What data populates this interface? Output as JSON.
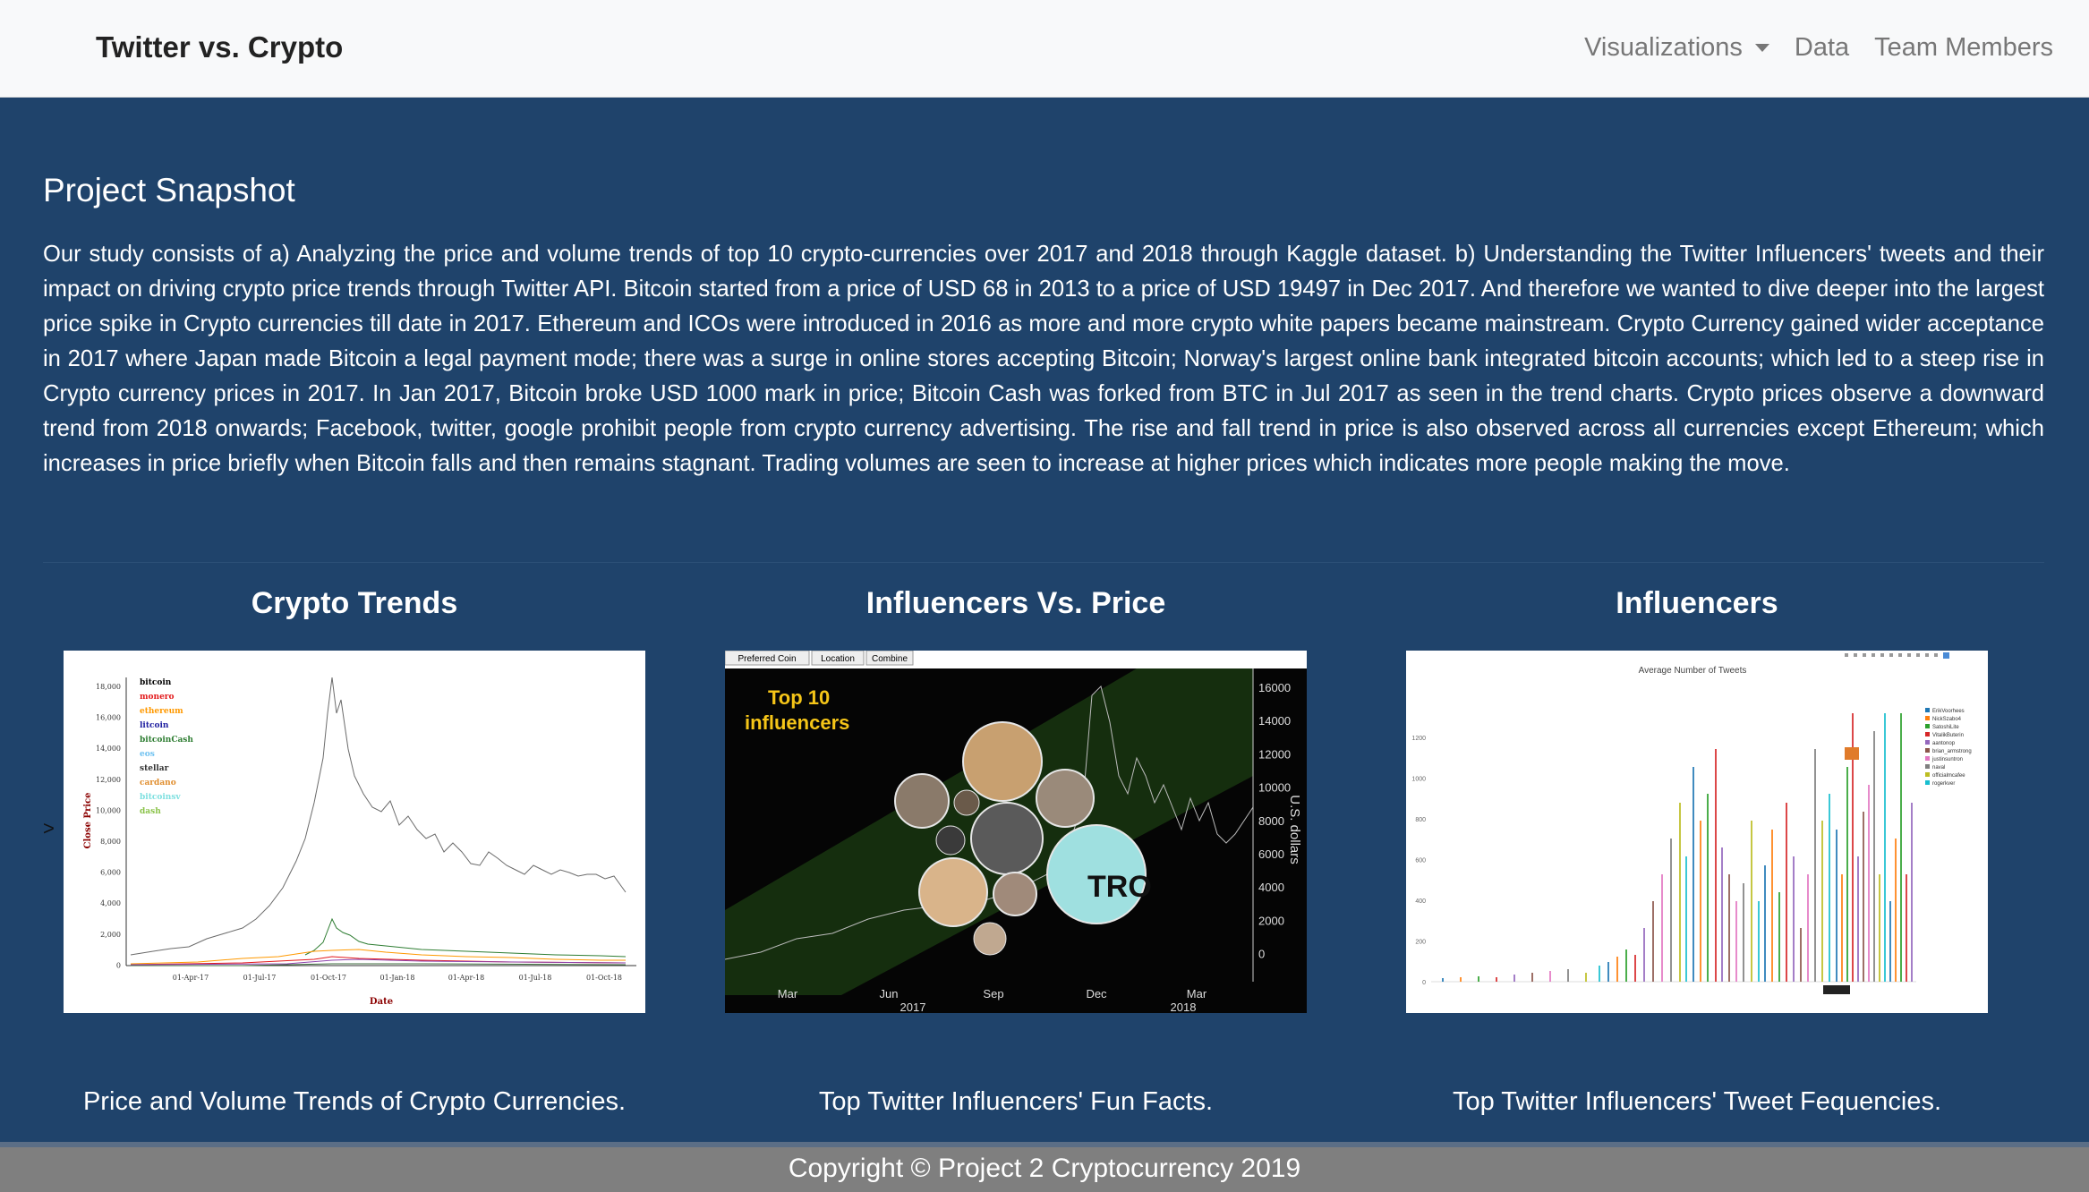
{
  "navbar": {
    "brand": "Twitter vs. Crypto",
    "items": [
      {
        "label": "Visualizations",
        "dropdown": true
      },
      {
        "label": "Data"
      },
      {
        "label": "Team Members"
      }
    ]
  },
  "snapshot": {
    "title": "Project Snapshot",
    "text": "Our study consists of a) Analyzing the price and volume trends of top 10 crypto-currencies over 2017 and 2018 through Kaggle dataset. b) Understanding the Twitter Influencers' tweets and their impact on driving crypto price trends through Twitter API. Bitcoin started from a price of USD 68 in 2013 to a price of USD 19497 in Dec 2017. And therefore we wanted to dive deeper into the largest price spike in Crypto currencies till date in 2017. Ethereum and ICOs were introduced in 2016 as more and more crypto white papers became mainstream. Crypto Currency gained wider acceptance in 2017 where Japan made Bitcoin a legal payment mode; there was a surge in online stores accepting Bitcoin; Norway's largest online bank integrated bitcoin accounts; which led to a steep rise in Crypto currency prices in 2017. In Jan 2017, Bitcoin broke USD 1000 mark in price; Bitcoin Cash was forked from BTC in Jul 2017 as seen in the trend charts. Crypto prices observe a downward trend from 2018 onwards; Facebook, twitter, google prohibit people from crypto currency advertising. The rise and fall trend in price is also observed across all currencies except Ethereum; which increases in price briefly when Bitcoin falls and then remains stagnant. Trading volumes are seen to increase at higher prices which indicates more people making the move."
  },
  "cards": [
    {
      "title": "Crypto Trends",
      "caption": "Price and Volume Trends of Crypto Currencies.",
      "thumb": {
        "legend": [
          "bitcoin",
          "monero",
          "ethereum",
          "litcoin",
          "bitcoinCash",
          "eos",
          "stellar",
          "cardano",
          "bitcoinsv",
          "dash"
        ],
        "legend_colors": [
          "#000000",
          "#e31a1c",
          "#ff9900",
          "#1f1fa0",
          "#2e7d32",
          "#6ec1f0",
          "#333333",
          "#e08e2f",
          "#7fe0e0",
          "#8bc34a"
        ],
        "y_label": "Close Price",
        "x_label": "Date",
        "y_ticks": [
          "18,000",
          "16,000",
          "14,000",
          "12,000",
          "10,000",
          "8,000",
          "6,000",
          "4,000",
          "2,000",
          "0"
        ],
        "x_ticks": [
          "01-Apr-17",
          "01-Jul-17",
          "01-Oct-17",
          "01-Jan-18",
          "01-Apr-18",
          "01-Jul-18",
          "01-Oct-18"
        ]
      }
    },
    {
      "title": "Influencers Vs. Price",
      "caption": "Top Twitter Influencers' Fun Facts.",
      "thumb": {
        "tabs": [
          "Preferred Coin",
          "Location",
          "Combine"
        ],
        "heading": "Top 10\ninfluencers",
        "y_label": "U.S. dollars",
        "y_ticks": [
          "16000",
          "14000",
          "12000",
          "10000",
          "8000",
          "6000",
          "4000",
          "2000",
          "0"
        ],
        "x_ticks": [
          "Mar",
          "Jun",
          "Sep",
          "Dec",
          "Mar"
        ],
        "x_years": [
          "2017",
          "2018"
        ],
        "bubble_text": "TRO"
      }
    },
    {
      "title": "Influencers",
      "caption": "Top Twitter Influencers' Tweet Fequencies.",
      "thumb": {
        "title": "Average Number of Tweets",
        "legend": [
          "ErikVoorhees",
          "NickSzabo4",
          "SatoshiLite",
          "VitalikButerin",
          "aantonop",
          "brian_armstrong",
          "justinsuntron",
          "naval",
          "officialmcafee",
          "rogerkver"
        ],
        "legend_colors": [
          "#1f77b4",
          "#ff7f0e",
          "#2ca02c",
          "#d62728",
          "#9467bd",
          "#8c564b",
          "#e377c2",
          "#7f7f7f",
          "#bcbd22",
          "#17becf"
        ],
        "y_ticks": [
          "1200",
          "1000",
          "800",
          "600",
          "400",
          "200",
          "0"
        ]
      }
    }
  ],
  "footer": {
    "text": "Copyright © Project 2 Cryptocurrency 2019"
  }
}
